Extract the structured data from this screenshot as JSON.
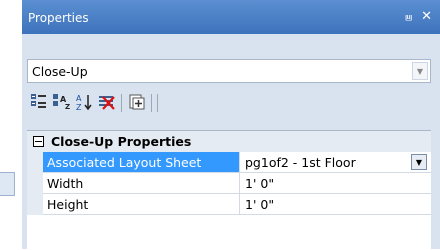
{
  "panel": {
    "title": "Properties",
    "pin_glyph": "⩏",
    "close_glyph": "✕"
  },
  "object_selector": {
    "value": "Close-Up",
    "arrow_glyph": "▼"
  },
  "toolbar": {
    "icons": [
      "categorized-icon",
      "alphabetical-icon",
      "sort-az-icon",
      "delete-icon",
      "property-pages-icon"
    ]
  },
  "grid": {
    "category": "Close-Up Properties",
    "rows": [
      {
        "name": "Associated Layout Sheet",
        "value": "pg1of2 - 1st Floor",
        "selected": true,
        "has_dropdown": true
      },
      {
        "name": "Width",
        "value": "1' 0\"",
        "selected": false,
        "has_dropdown": false
      },
      {
        "name": "Height",
        "value": "1' 0\"",
        "selected": false,
        "has_dropdown": false
      }
    ],
    "dropdown_glyph": "▼"
  },
  "colors": {
    "titlebar": "#4a7fc6",
    "selection": "#3399ff",
    "panel_bg": "#d9e3f0"
  }
}
